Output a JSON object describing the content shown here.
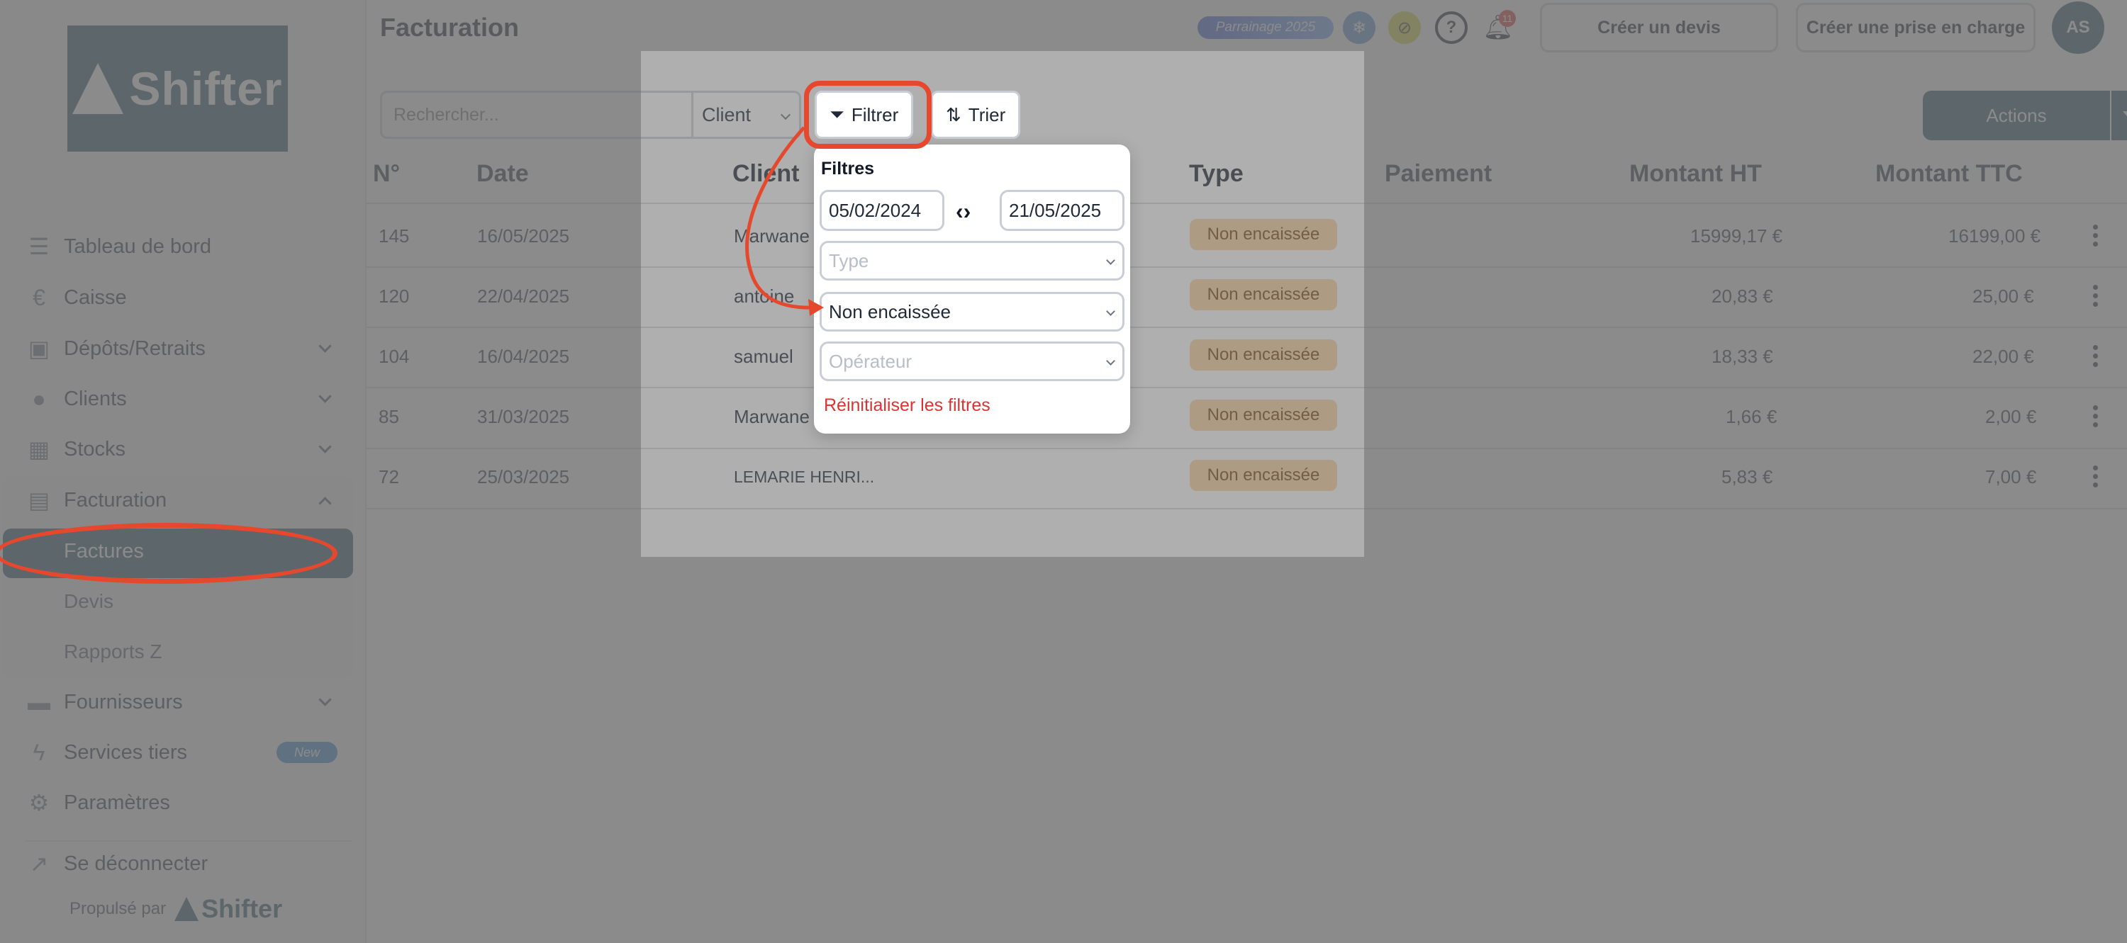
{
  "app": {
    "logo_text": "Shifter"
  },
  "sidebar": {
    "items": [
      {
        "label": "Tableau de bord",
        "icon": "list-icon"
      },
      {
        "label": "Caisse",
        "icon": "euro-icon"
      },
      {
        "label": "Dépôts/Retraits",
        "icon": "wallet-icon"
      },
      {
        "label": "Clients",
        "icon": "user-icon"
      },
      {
        "label": "Stocks",
        "icon": "boxes-icon"
      },
      {
        "label": "Facturation",
        "icon": "document-icon"
      },
      {
        "label": "Fournisseurs",
        "icon": "truck-icon"
      },
      {
        "label": "Services tiers",
        "icon": "bolt-icon"
      },
      {
        "label": "Paramètres",
        "icon": "gear-icon"
      }
    ],
    "facturation_sub": [
      "Factures",
      "Devis",
      "Rapports Z"
    ],
    "new_badge": "New",
    "logout": "Se déconnecter",
    "powered_by": "Propulsé par",
    "powered_brand": "Shifter"
  },
  "header": {
    "title": "Facturation",
    "parrainage": "Parrainage 2025",
    "notification_count": "11",
    "create_quote": "Créer un devis",
    "create_charge": "Créer une prise en charge",
    "avatar": "AS"
  },
  "toolbar": {
    "search_placeholder": "Rechercher...",
    "client_select": "Client",
    "filter": "Filtrer",
    "sort": "Trier",
    "actions": "Actions"
  },
  "table": {
    "columns": [
      "N°",
      "Date",
      "Client",
      "Type",
      "Paiement",
      "Montant HT",
      "Montant TTC"
    ],
    "rows": [
      {
        "num": "145",
        "date": "16/05/2025",
        "client": "Marwane",
        "type": "Non encaissée",
        "ht": "15999,17 €",
        "ttc": "16199,00 €"
      },
      {
        "num": "120",
        "date": "22/04/2025",
        "client": "antoine",
        "type": "Non encaissée",
        "ht": "20,83 €",
        "ttc": "25,00 €"
      },
      {
        "num": "104",
        "date": "16/04/2025",
        "client": "samuel",
        "type": "Non encaissée",
        "ht": "18,33 €",
        "ttc": "22,00 €"
      },
      {
        "num": "85",
        "date": "31/03/2025",
        "client": "Marwane",
        "type": "Non encaissée",
        "ht": "1,66 €",
        "ttc": "2,00 €"
      },
      {
        "num": "72",
        "date": "25/03/2025",
        "client": "LEMARIE HENRI...",
        "type": "Non encaissée",
        "ht": "5,83 €",
        "ttc": "7,00 €"
      }
    ]
  },
  "filters": {
    "title": "Filtres",
    "date_from": "05/02/2024",
    "date_to": "21/05/2025",
    "type_placeholder": "Type",
    "status_value": "Non encaissée",
    "operator_placeholder": "Opérateur",
    "reset": "Réinitialiser les filtres"
  },
  "colors": {
    "brand": "#1d4a63",
    "highlight": "#e5482d",
    "badge_bg": "#fbd3a0",
    "reset": "#e03131"
  }
}
